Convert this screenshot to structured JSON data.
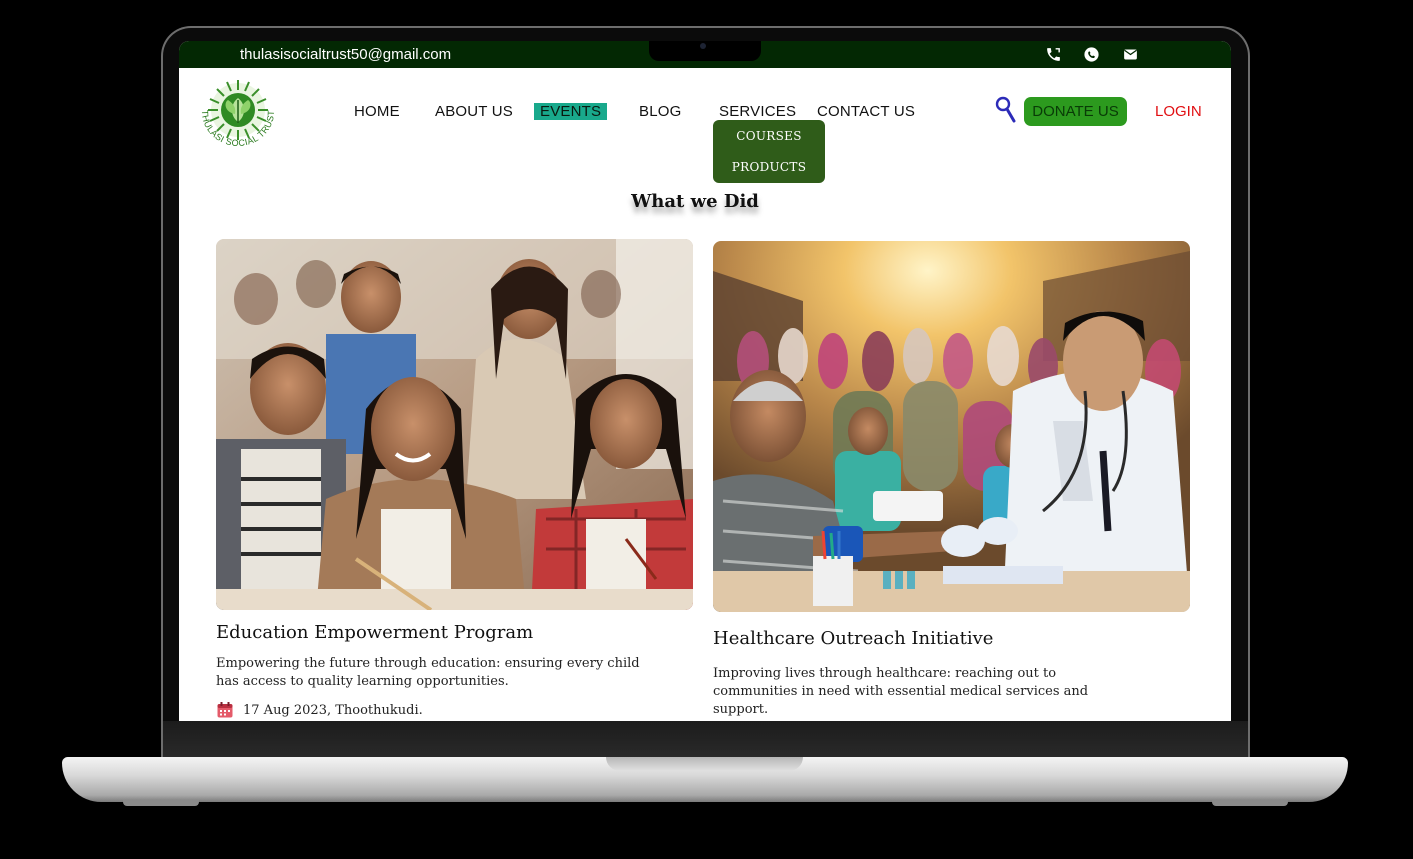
{
  "topbar": {
    "email": "thulasisocialtrust50@gmail.com",
    "icons": [
      "phone-icon",
      "whatsapp-icon",
      "mail-icon"
    ]
  },
  "header": {
    "logo_text": "THULASI SOCIAL TRUST",
    "nav": {
      "home": "HOME",
      "about": "ABOUT US",
      "events": "EVENTS",
      "blog": "BLOG",
      "services": "SERVICES",
      "contact": "CONTACT US"
    },
    "services_menu": [
      "COURSES",
      "PRODUCTS"
    ],
    "donate_label": "DONATE US",
    "login_label": "LOGIN"
  },
  "main": {
    "section_title": "What we Did",
    "cards": [
      {
        "title": "Education Empowerment Program",
        "description": "Empowering the future through education: ensuring every child has access to quality learning opportunities.",
        "meta": "17 Aug 2023, Thoothukudi."
      },
      {
        "title": "Healthcare Outreach Initiative",
        "description": "Improving lives through healthcare: reaching out to communities in need with essential medical services and support."
      }
    ]
  },
  "colors": {
    "topbar_bg": "#032803",
    "active_nav": "#19a98c",
    "donate_bg": "#2c9a1e",
    "dropdown_bg": "#2f5c19",
    "login": "#e10f12"
  }
}
